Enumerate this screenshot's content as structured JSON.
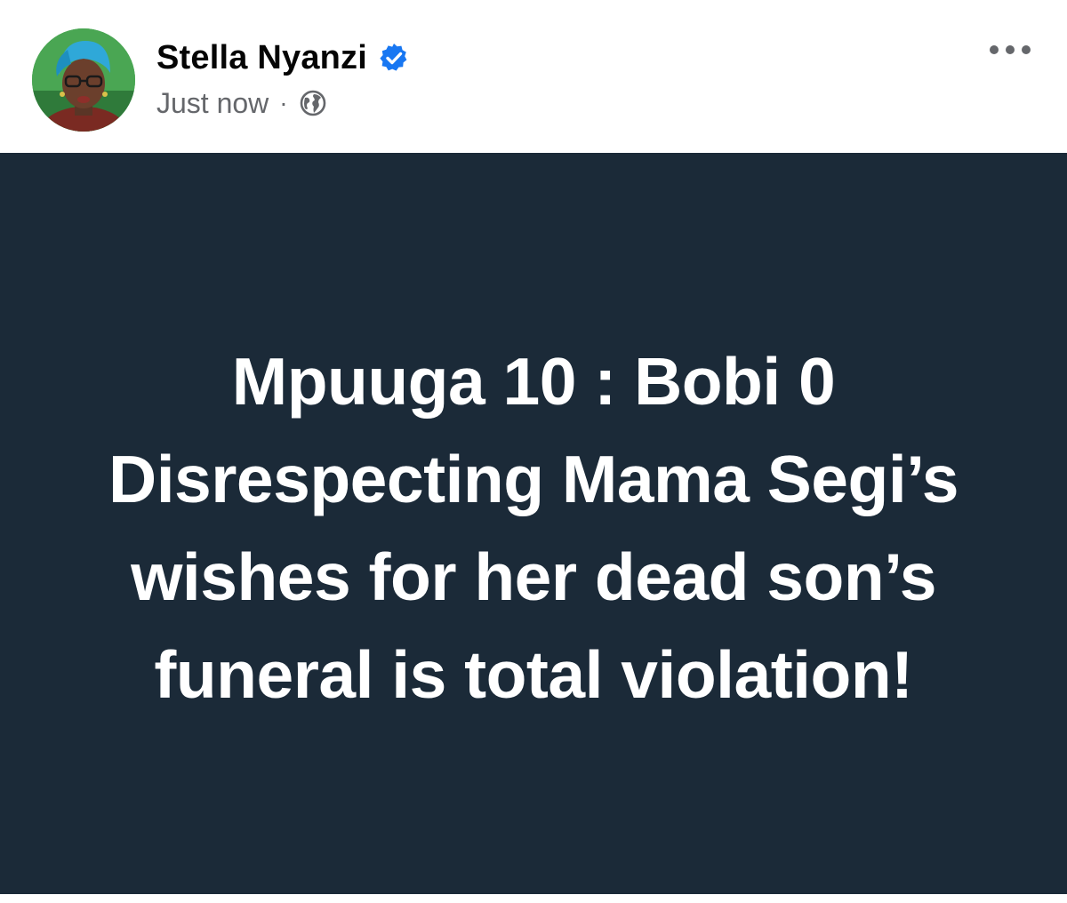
{
  "author": {
    "name": "Stella Nyanzi",
    "verified_icon": "verified-badge-icon",
    "avatar_icon": "profile-photo"
  },
  "meta": {
    "timestamp": "Just now",
    "separator": "·",
    "audience_icon": "globe-icon"
  },
  "menu": {
    "icon": "more-options-icon"
  },
  "post": {
    "text": "Mpuuga 10 : Bobi 0 Disrespecting Mama Segi’s wishes for her dead son’s funeral is total violation!"
  },
  "colors": {
    "card_background": "#1b2a38",
    "post_text": "#ffffff",
    "name_text": "#050505",
    "meta_text": "#65676b",
    "verified": "#1877f2"
  }
}
